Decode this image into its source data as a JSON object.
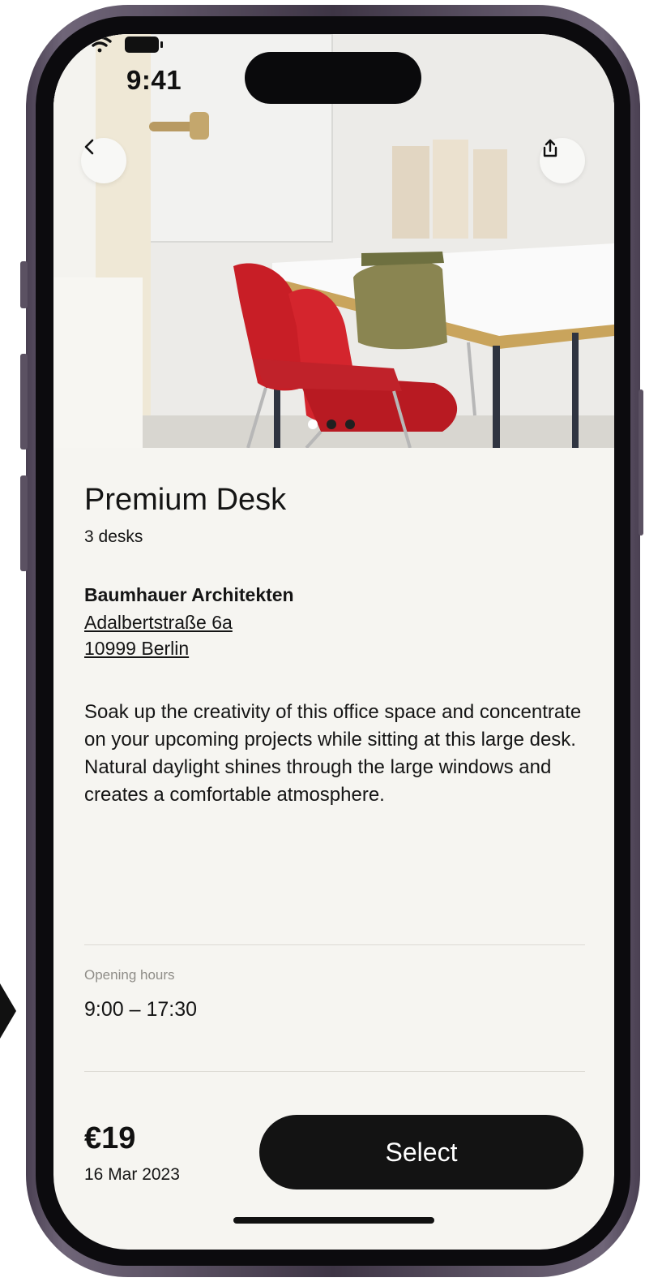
{
  "status_bar": {
    "time": "9:41"
  },
  "header": {
    "back_icon": "chevron-left-icon",
    "share_icon": "share-icon"
  },
  "carousel": {
    "count": 3,
    "active_index": 0
  },
  "listing": {
    "title": "Premium Desk",
    "subtitle": "3 desks",
    "company": "Baumhauer Architekten",
    "address_line1": "Adalbertstraße 6a",
    "address_line2": "10999 Berlin",
    "description": "Soak up the creativity of this office space and concentrate on your upcoming projects while sitting at this large desk. Natural daylight shines through the large windows and creates a comfortable atmosphere."
  },
  "opening_hours": {
    "label": "Opening hours",
    "value": "9:00 – 17:30"
  },
  "footer": {
    "price": "€19",
    "date": "16 Mar 2023",
    "select_label": "Select"
  },
  "colors": {
    "background": "#f6f5f1",
    "button": "#131313",
    "accent_chair": "#c81e26"
  }
}
